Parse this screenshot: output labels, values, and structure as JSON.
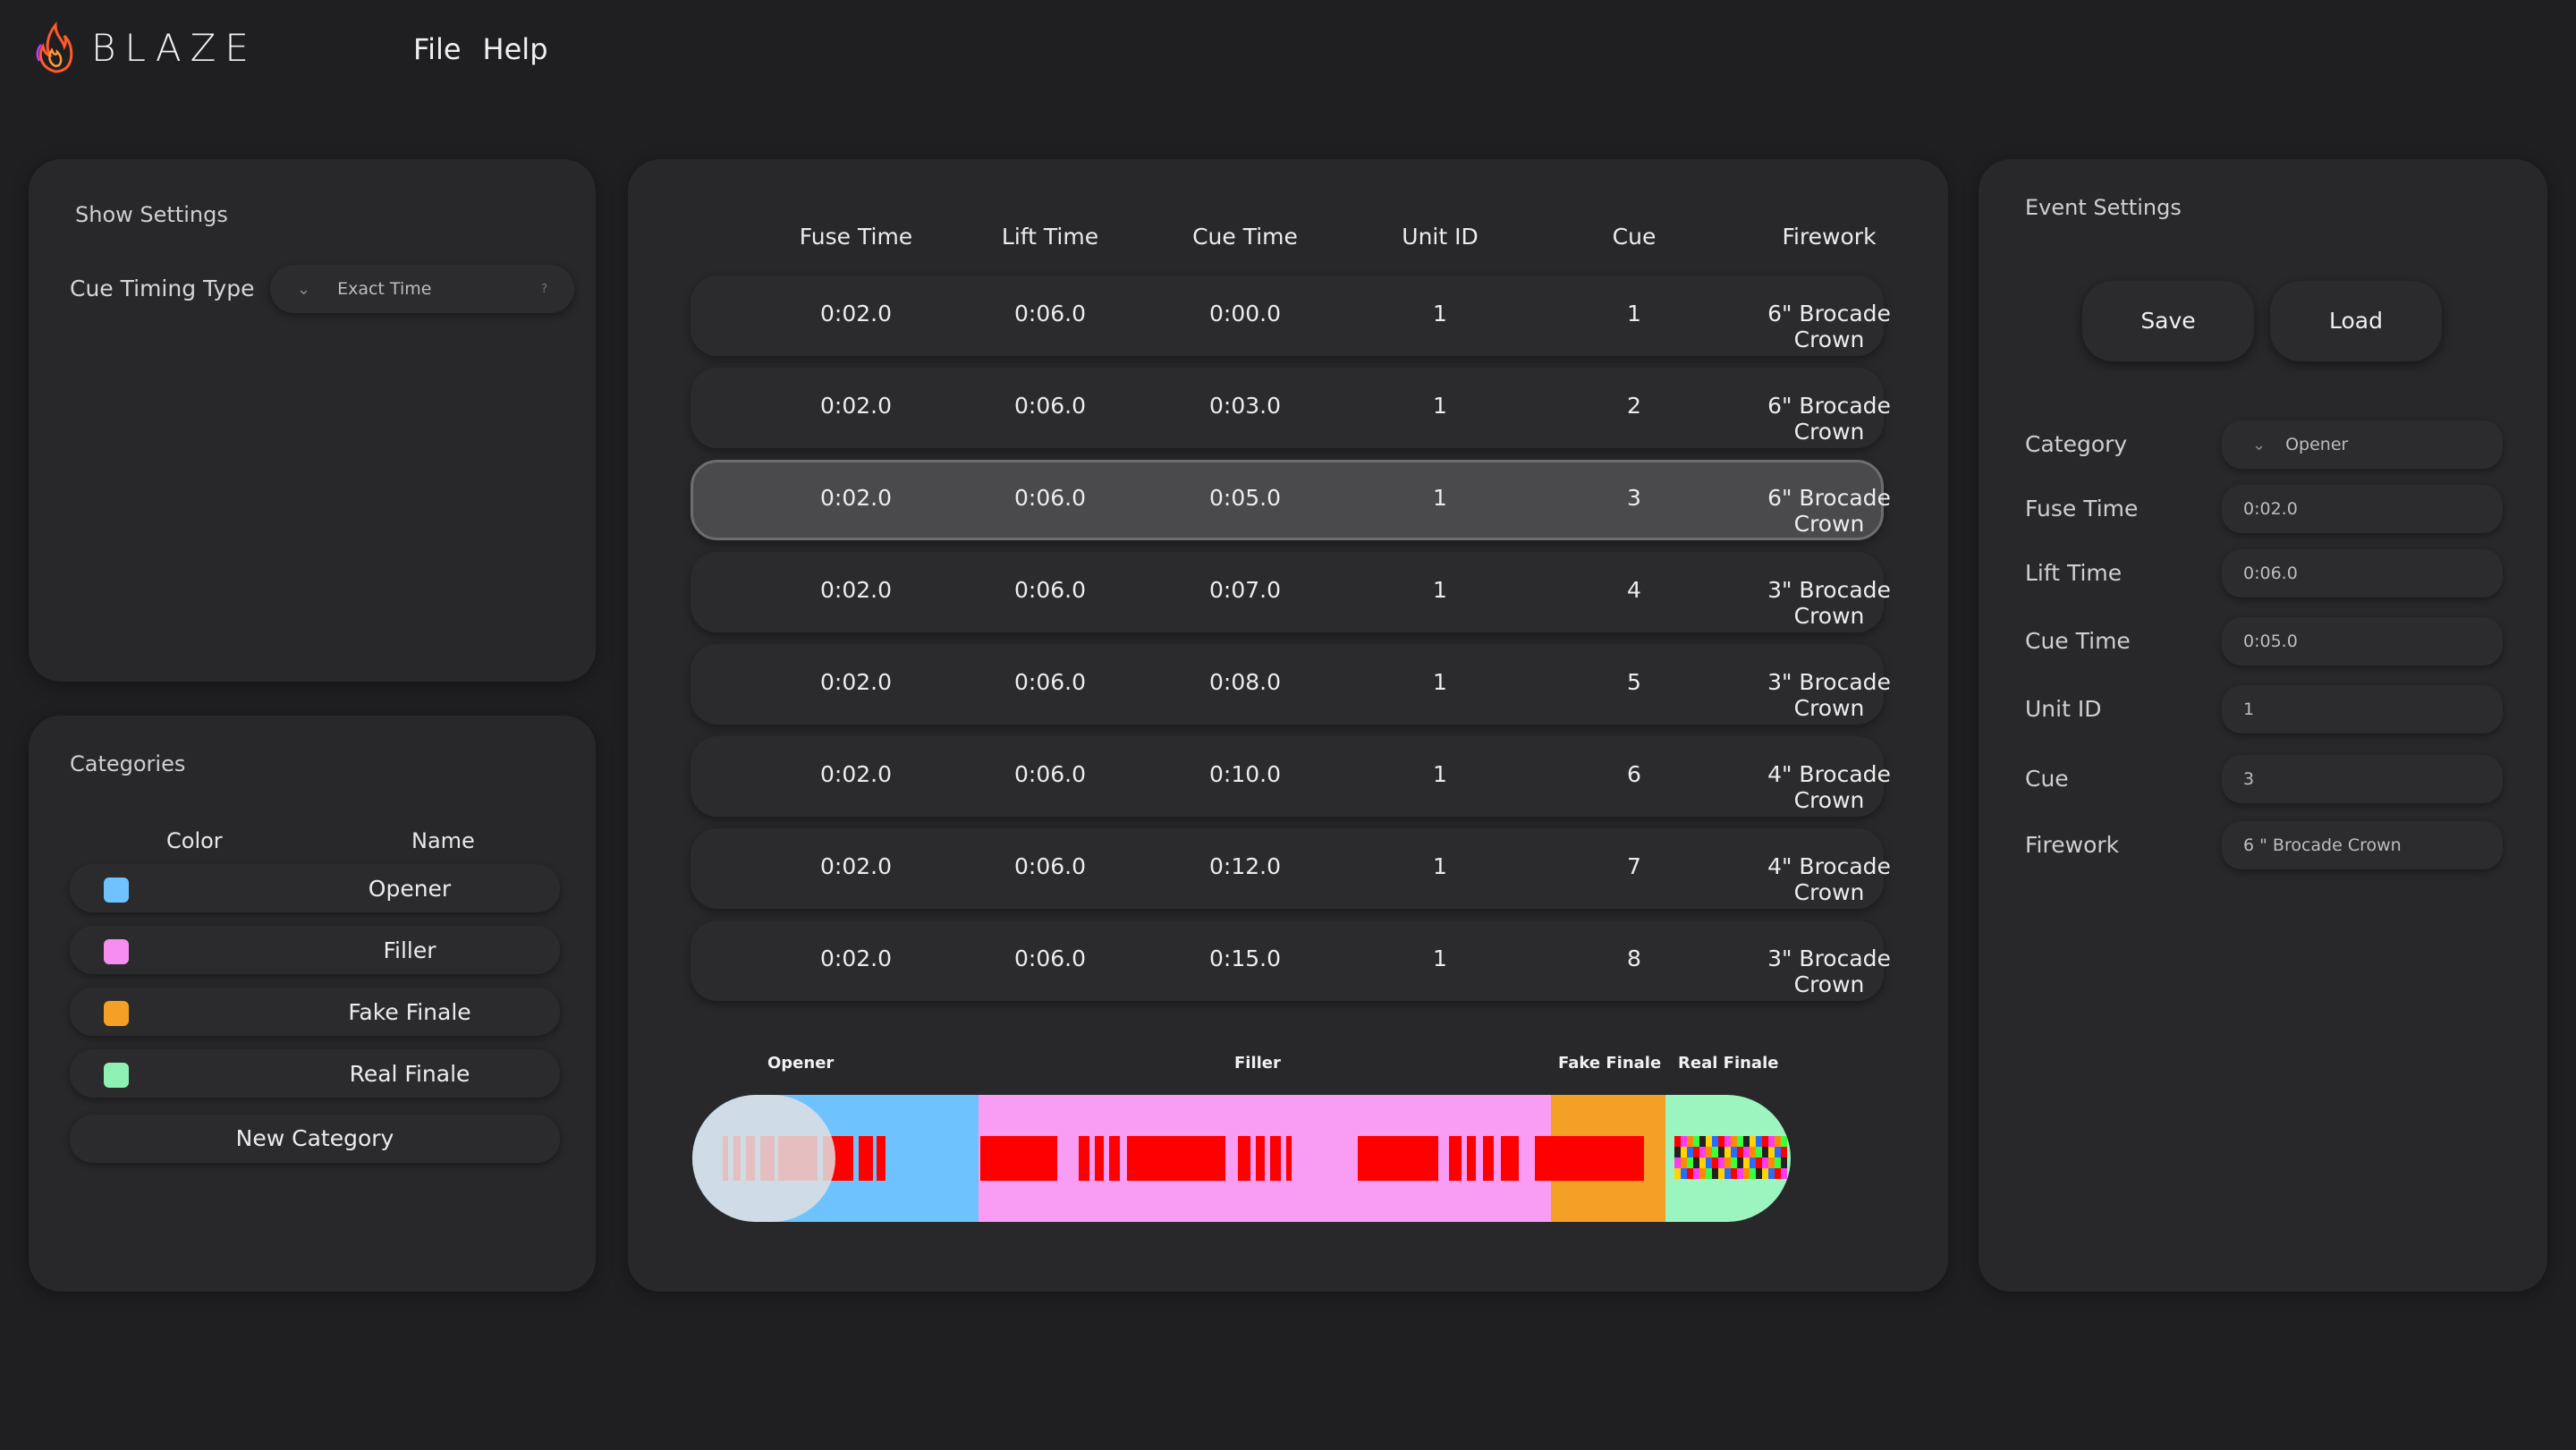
{
  "app": {
    "name": "BLAZE"
  },
  "menu": [
    {
      "label": "File"
    },
    {
      "label": "Help"
    }
  ],
  "show_settings": {
    "title": "Show Settings",
    "cue_timing_label": "Cue Timing Type",
    "cue_timing_value": "Exact Time",
    "help_glyph": "?"
  },
  "categories": {
    "title": "Categories",
    "col_color": "Color",
    "col_name": "Name",
    "items": [
      {
        "name": "Opener",
        "color": "#6ec3ff"
      },
      {
        "name": "Filler",
        "color": "#f78df0"
      },
      {
        "name": "Fake Finale",
        "color": "#f4a026"
      },
      {
        "name": "Real Finale",
        "color": "#8ff0b4"
      }
    ],
    "new_label": "New Category"
  },
  "table": {
    "headers": [
      "Fuse Time",
      "Lift Time",
      "Cue Time",
      "Unit ID",
      "Cue",
      "Firework"
    ],
    "selected_index": 2,
    "rows": [
      [
        "0:02.0",
        "0:06.0",
        "0:00.0",
        "1",
        "1",
        "6\" Brocade Crown"
      ],
      [
        "0:02.0",
        "0:06.0",
        "0:03.0",
        "1",
        "2",
        "6\" Brocade Crown"
      ],
      [
        "0:02.0",
        "0:06.0",
        "0:05.0",
        "1",
        "3",
        "6\" Brocade Crown"
      ],
      [
        "0:02.0",
        "0:06.0",
        "0:07.0",
        "1",
        "4",
        "3\" Brocade Crown"
      ],
      [
        "0:02.0",
        "0:06.0",
        "0:08.0",
        "1",
        "5",
        "3\" Brocade Crown"
      ],
      [
        "0:02.0",
        "0:06.0",
        "0:10.0",
        "1",
        "6",
        "4\" Brocade Crown"
      ],
      [
        "0:02.0",
        "0:06.0",
        "0:12.0",
        "1",
        "7",
        "4\" Brocade Crown"
      ],
      [
        "0:02.0",
        "0:06.0",
        "0:15.0",
        "1",
        "8",
        "3\" Brocade Crown"
      ]
    ]
  },
  "timeline": {
    "labels": [
      "Opener",
      "Filler",
      "Fake Finale",
      "Real Finale"
    ]
  },
  "event_settings": {
    "title": "Event Settings",
    "save_label": "Save",
    "load_label": "Load",
    "fields": [
      {
        "label": "Category",
        "value": "Opener"
      },
      {
        "label": "Fuse Time",
        "value": "0:02.0"
      },
      {
        "label": "Lift Time",
        "value": "0:06.0"
      },
      {
        "label": "Cue Time",
        "value": "0:05.0"
      },
      {
        "label": "Unit ID",
        "value": "1"
      },
      {
        "label": "Cue",
        "value": "3"
      },
      {
        "label": "Firework",
        "value": "6 \" Brocade Crown"
      }
    ]
  }
}
